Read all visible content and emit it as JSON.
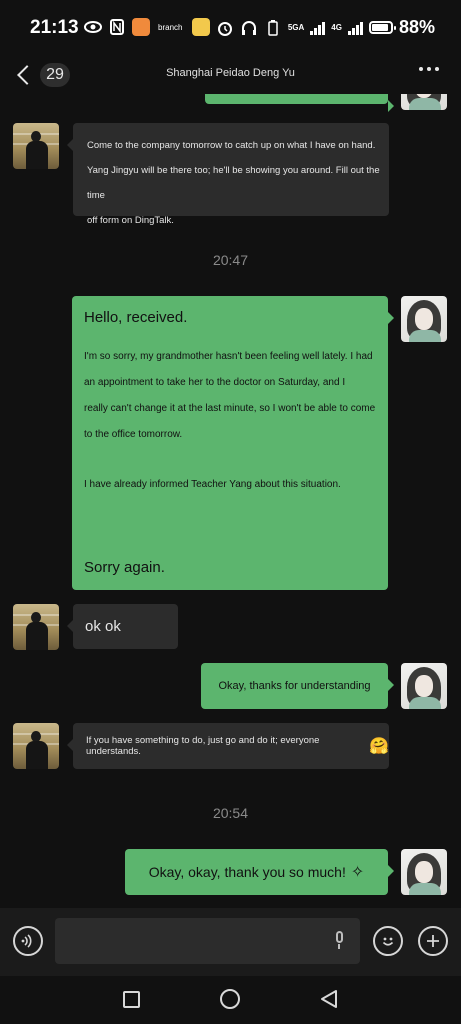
{
  "status_bar": {
    "time": "21:13",
    "branch_label": "branch",
    "network_1": "5GA",
    "network_2": "4G",
    "battery_percent": "88%",
    "battery_level": 0.88
  },
  "nav": {
    "unread_count": "29",
    "title": "Shanghai Peidao Deng Yu"
  },
  "messages": [
    {
      "side": "in",
      "lines": [
        "Come to the company tomorrow to catch up on what I have on hand.",
        "Yang Jingyu will be there too; he'll be showing you around. Fill out the time",
        "off form on DingTalk."
      ]
    },
    {
      "type": "time",
      "text": "20:47"
    },
    {
      "side": "out",
      "greeting": "Hello, received.",
      "lines": [
        "I'm so sorry, my grandmother hasn't been feeling well lately. I had",
        "an appointment to take her to the doctor on Saturday, and I",
        "really can't change it at the last minute, so I won't be able to come",
        "to the office tomorrow."
      ],
      "line2": "I have already informed Teacher Yang about this situation.",
      "closing": "Sorry again."
    },
    {
      "side": "in",
      "text": "ok ok"
    },
    {
      "side": "out",
      "text": "Okay, thanks for understanding"
    },
    {
      "side": "in",
      "text": "If you have something to do, just go and do it; everyone understands.",
      "emoji": "🤗"
    },
    {
      "type": "time",
      "text": "20:54"
    },
    {
      "side": "out",
      "text": "Okay, okay, thank you so much!",
      "emoji": "✧"
    }
  ],
  "input": {
    "placeholder": ""
  },
  "icons": {
    "voice": "voice-icon",
    "emoji": "emoji-icon",
    "plus": "plus-icon"
  },
  "colors": {
    "background": "#111111",
    "incoming_bubble": "#2c2c2c",
    "outgoing_bubble": "#5cb56e"
  }
}
